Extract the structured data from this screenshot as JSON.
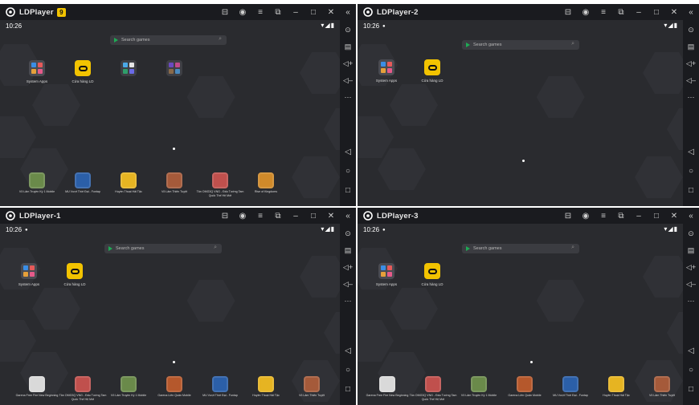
{
  "windows": [
    {
      "title": "LDPlayer",
      "badge": "9",
      "time": "10:26",
      "status_right": "▾◢▮",
      "search_placeholder": "Search games",
      "home_icons": [
        {
          "label": "System Apps",
          "kind": "sysapps"
        },
        {
          "label": "Cửa hàng LD",
          "kind": "store"
        },
        {
          "label": "",
          "kind": "folder-a"
        },
        {
          "label": "",
          "kind": "folder-b"
        }
      ],
      "games": [
        {
          "label": "Võ Lâm Truyền Kỳ 1 Mobile",
          "color": "#6a8a4a"
        },
        {
          "label": "MU Vượt Thời Đại - Funtap",
          "color": "#2b5fa8"
        },
        {
          "label": "Huyền Thoại Hải Tặc",
          "color": "#e6b422"
        },
        {
          "label": "Võ Lâm Thiên Tuyệt",
          "color": "#a55a3a"
        },
        {
          "label": "Tân OMG3Q VNG - Đấu Tướng Tam Quốc Thế Hệ Mới",
          "color": "#c0504d"
        },
        {
          "label": "Rise of Kingdoms",
          "color": "#d08a2a"
        }
      ]
    },
    {
      "title": "LDPlayer-2",
      "time": "10:26",
      "status_right": "▾◢▮",
      "search_placeholder": "Search games",
      "home_icons": [
        {
          "label": "System Apps",
          "kind": "sysapps"
        },
        {
          "label": "Cửa hàng LD",
          "kind": "store"
        }
      ],
      "games": []
    },
    {
      "title": "LDPlayer-1",
      "time": "10:26",
      "status_right": "▾◢▮",
      "search_placeholder": "Search games",
      "home_icons": [
        {
          "label": "System Apps",
          "kind": "sysapps"
        },
        {
          "label": "Cửa hàng LD",
          "kind": "store"
        }
      ],
      "games": []
    },
    {
      "title": "LDPlayer-3",
      "time": "10:26",
      "status_right": "▾◢▮",
      "search_placeholder": "Search games",
      "home_icons": [
        {
          "label": "System Apps",
          "kind": "sysapps"
        },
        {
          "label": "Cửa hàng LD",
          "kind": "store"
        }
      ],
      "games": []
    }
  ],
  "bottom_games_left": [
    {
      "label": "Garena Free Fire New Beginning",
      "color": "#d9d9d9"
    },
    {
      "label": "Tân OMG3Q VNG - Đấu Tướng Tam Quốc Thế Hệ Mới",
      "color": "#c0504d"
    },
    {
      "label": "Võ Lâm Truyền Kỳ 1 Mobile",
      "color": "#6a8a4a"
    },
    {
      "label": "Garena Liên Quân Mobile",
      "color": "#b5582c"
    },
    {
      "label": "MU Vượt Thời Đại - Funtap",
      "color": "#2b5fa8"
    },
    {
      "label": "Huyền Thoại Hải Tặc",
      "color": "#e6b422"
    },
    {
      "label": "Võ Lâm Thiên Tuyệt",
      "color": "#a55a3a"
    }
  ],
  "bottom_games_right": [
    {
      "label": "Garena Free Fire New Beginning",
      "color": "#d9d9d9"
    },
    {
      "label": "Tân OMG3Q VNG - Đấu Tướng Tam Quốc Thế Hệ Mới",
      "color": "#c0504d"
    },
    {
      "label": "Võ Lâm Truyền Kỳ 1 Mobile",
      "color": "#6a8a4a"
    },
    {
      "label": "Garena Liên Quân Mobile",
      "color": "#b5582c"
    },
    {
      "label": "MU Vượt Thời Đại - Funtap",
      "color": "#2b5fa8"
    },
    {
      "label": "Huyền Thoại Hải Tặc",
      "color": "#e6b422"
    },
    {
      "label": "Võ Lâm Thiên Tuyệt",
      "color": "#a55a3a"
    }
  ],
  "titlebar_buttons": [
    "gamepad-icon",
    "account-icon",
    "menu-icon",
    "restore-icon",
    "minimize-icon",
    "maximize-icon",
    "close-icon"
  ],
  "sidebar_collapse": "«",
  "sidebar_buttons": [
    "settings-icon",
    "keyboard-icon",
    "volume-up-icon",
    "volume-down-icon",
    "more-icon"
  ],
  "nav_buttons": [
    "back-icon",
    "home-icon",
    "recents-icon"
  ]
}
